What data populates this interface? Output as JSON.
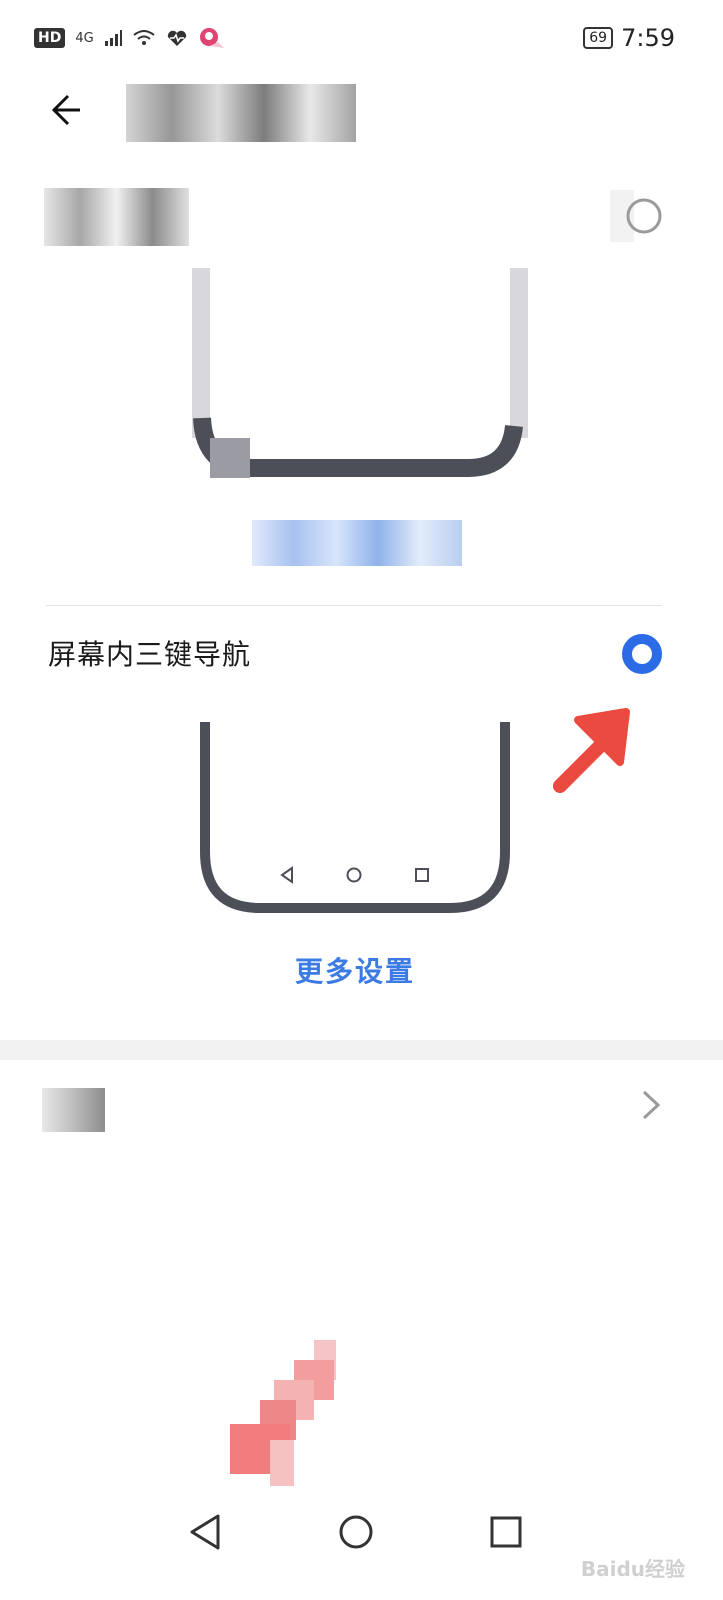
{
  "status_bar": {
    "left_icons": [
      "HD",
      "4G",
      "signal-bars",
      "wifi-icon",
      "health-heart-icon",
      "app-notification-icon"
    ],
    "hd_label": "HD",
    "network_label": "4G",
    "battery": "69",
    "time": "7:59"
  },
  "header": {
    "back_icon": "back-arrow-icon"
  },
  "options": [
    {
      "label": "",
      "selected": false
    },
    {
      "label": "屏幕内三键导航",
      "selected": true
    }
  ],
  "more_settings": "更多设置",
  "nav_bar": {
    "buttons": [
      "back-triangle-icon",
      "home-circle-icon",
      "recents-square-icon"
    ]
  },
  "watermark": "Baidu经验",
  "colors": {
    "accent": "#2b6be6",
    "link": "#3c7be3",
    "annotation_arrow": "#ea4a3f",
    "phone_outline": "#4c4e58"
  }
}
